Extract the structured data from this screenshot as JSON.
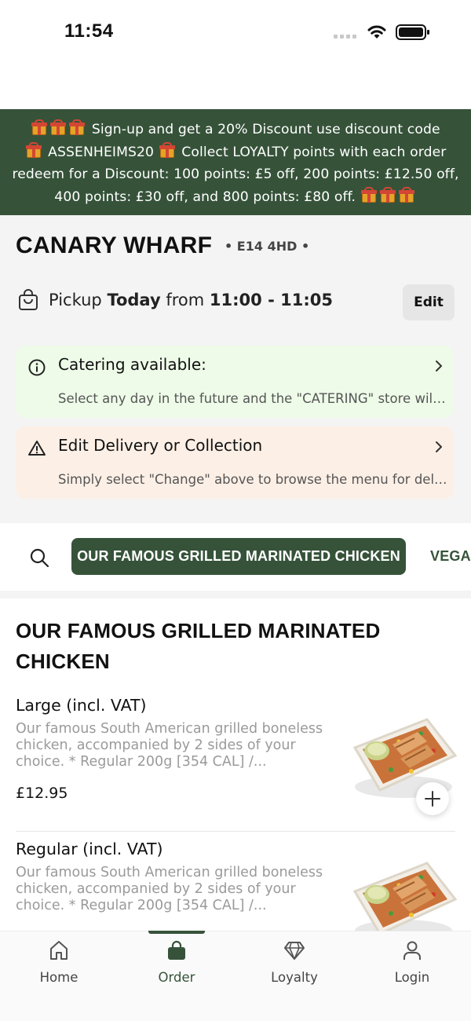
{
  "status_bar": {
    "time": "11:54"
  },
  "promo_banner": {
    "line1": "Sign-up and get a 20% Discount use discount code",
    "line2a": "ASSENHEIMS20",
    "line2b": "Collect LOYALTY points with each order",
    "line3": "redeem for a Discount: 100 points: £5 off, 200 points: £12.50 off,",
    "line4": "400 points: £30 off, and 800 points: £80 off."
  },
  "store": {
    "name": "CANARY WHARF",
    "postcode": "• E14 4HD •",
    "pickup_label": "Pickup",
    "pickup_day": "Today",
    "pickup_from": "from",
    "pickup_time": "11:00 - 11:05",
    "edit_label": "Edit"
  },
  "info_cards": [
    {
      "title": "Catering available:",
      "body": "Select any day in the future and the \"CATERING\" store will be available",
      "icon": "info-icon"
    },
    {
      "title": "Edit Delivery or Collection",
      "body": "Simply select \"Change\" above to browse the menu for delivery",
      "icon": "warning-icon"
    }
  ],
  "categories": {
    "active": "OUR FAMOUS GRILLED MARINATED CHICKEN",
    "next": "VEGAN"
  },
  "menu": {
    "section_title": "OUR FAMOUS GRILLED MARINATED CHICKEN",
    "products": [
      {
        "name": "Large (incl. VAT)",
        "description": "Our famous South American grilled boneless chicken, accompanied by 2 sides of your choice. * Regular 200g [354 CAL] /...",
        "price": "£12.95"
      },
      {
        "name": "Regular (incl. VAT)",
        "description": "Our famous South American grilled boneless chicken, accompanied by 2 sides of your choice. * Regular 200g [354 CAL] /...",
        "price": ""
      }
    ]
  },
  "bottom_nav": {
    "items": [
      {
        "label": "Home",
        "icon": "home-icon"
      },
      {
        "label": "Order",
        "icon": "bag-icon"
      },
      {
        "label": "Loyalty",
        "icon": "diamond-icon"
      },
      {
        "label": "Login",
        "icon": "user-icon"
      }
    ],
    "active": "Order"
  },
  "colors": {
    "brand_green": "#36533a",
    "catering_bg": "#eefbe8",
    "warning_bg": "#fcefe6"
  }
}
